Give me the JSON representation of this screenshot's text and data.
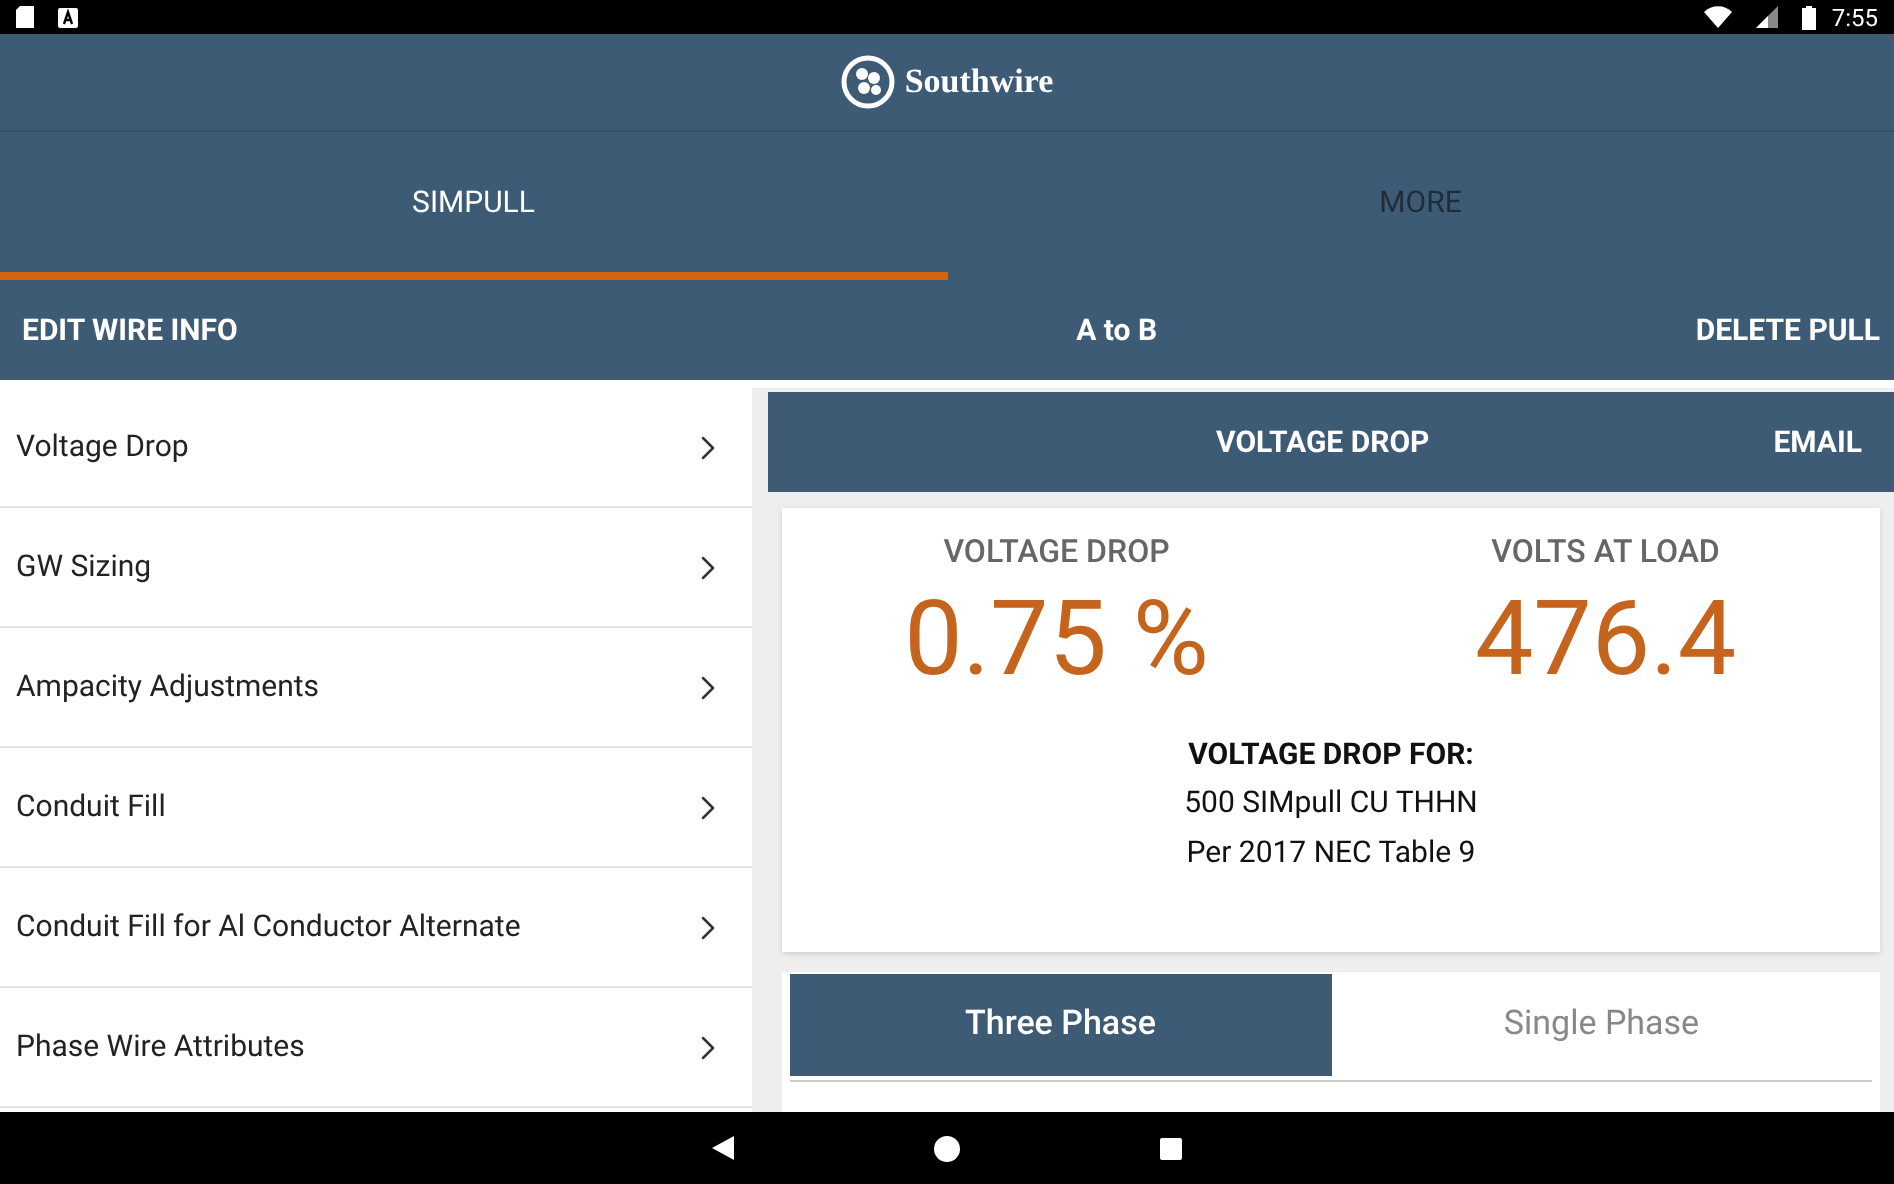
{
  "status_bar": {
    "time": "7:55"
  },
  "header": {
    "brand": "Southwire"
  },
  "tabs": [
    {
      "label": "SIMPULL",
      "selected": true
    },
    {
      "label": "MORE",
      "selected": false
    }
  ],
  "action_bar": {
    "left": "EDIT WIRE INFO",
    "center": "A to B",
    "right": "DELETE PULL"
  },
  "menu_items": [
    {
      "label": "Voltage Drop"
    },
    {
      "label": "GW Sizing"
    },
    {
      "label": "Ampacity Adjustments"
    },
    {
      "label": "Conduit Fill"
    },
    {
      "label": "Conduit Fill for Al Conductor Alternate"
    },
    {
      "label": "Phase Wire Attributes"
    }
  ],
  "panel": {
    "title": "VOLTAGE DROP",
    "action": "EMAIL",
    "results": [
      {
        "label": "VOLTAGE DROP",
        "value": "0.75 %"
      },
      {
        "label": "VOLTS AT LOAD",
        "value": "476.4"
      }
    ],
    "caption": "VOLTAGE DROP FOR:",
    "details": [
      "500 SIMpull CU THHN",
      "Per 2017 NEC Table 9"
    ],
    "phase_options": [
      {
        "label": "Three Phase",
        "selected": true
      },
      {
        "label": "Single Phase",
        "selected": false
      }
    ]
  }
}
